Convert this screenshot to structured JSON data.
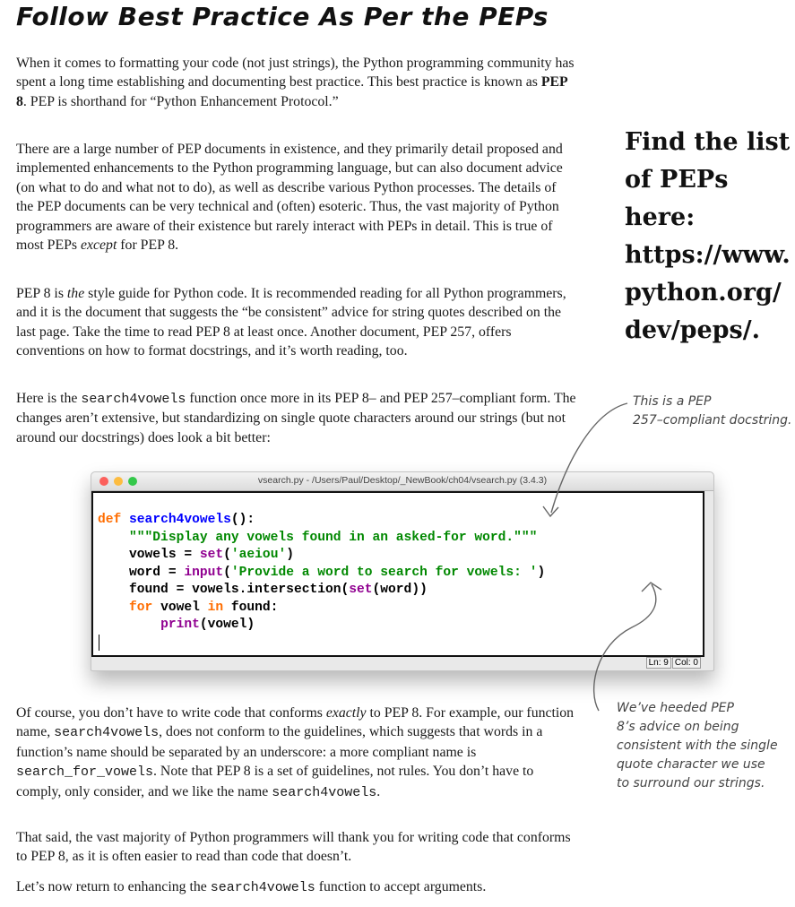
{
  "heading": "Follow Best Practice As Per the PEPs",
  "paragraphs": {
    "p1": {
      "a": "When it comes to formatting your code (not just strings), the Python programming community has spent a long time establishing and documenting best practice. This best practice is known as ",
      "b": "PEP 8",
      "c": ".  PEP is shorthand for “Python Enhancement Protocol.”"
    },
    "p2": {
      "a": "There are a large number of PEP documents in existence, and they primarily detail proposed and implemented enhancements to the Python programming language, but can also document advice (on what to do and what not to do), as well as describe various Python processes. The details of the PEP documents can be very technical and (often) esoteric. Thus, the vast majority of Python programmers are aware of their existence but rarely interact with PEPs in detail. This is true of most PEPs ",
      "b": "except",
      "c": " for PEP 8."
    },
    "p3": {
      "a": "PEP 8 is ",
      "b": "the",
      "c": " style guide for Python code. It is recommended reading for all Python programmers, and it is the document that suggests the “be consistent” advice for string quotes described on the last page. Take the time to read PEP 8 at least once. Another document, PEP 257, offers conventions on how to format docstrings, and it’s worth reading, too."
    },
    "p4": {
      "a": "Here is the ",
      "code": "search4vowels",
      "b": " function once more in its PEP 8– and PEP 257–compliant form. The changes aren’t extensive, but standardizing on single quote characters around our strings (but not around our docstrings) does look a bit better:"
    },
    "p5": {
      "a": "Of course, you don’t have to write code that conforms ",
      "b": "exactly",
      "c": " to PEP 8. For example, our function name, ",
      "code1": "search4vowels",
      "d": ", does not conform to the guidelines, which suggests that words in a function’s name should be separated by an underscore: a more compliant name is ",
      "code2": "search_for_vowels",
      "e": ". Note that PEP 8 is a set of guidelines, not rules. You don’t have to comply, only consider, and we like the name ",
      "code3": "search4vowels",
      "f": "."
    },
    "p6": "That said, the vast majority of Python programmers will thank you for writing code that conforms to PEP 8, as it is often easier to read than code that doesn’t.",
    "p7": {
      "a": "Let’s now return to enhancing the ",
      "code": "search4vowels",
      "b": " function to accept arguments."
    }
  },
  "callout": {
    "line1": "Find the list",
    "line2": "of PEPs here:",
    "line3": "https://www.",
    "line4": "python.org/",
    "line5": "dev/peps/."
  },
  "annotation_docstring": {
    "line1": "This is a PEP",
    "line2": "257–compliant docstring."
  },
  "annotation_quotes": {
    "line1": "We’ve heeded PEP",
    "line2": "8’s advice on being",
    "line3": "consistent with the single",
    "line4": "quote character we use",
    "line5": "to surround our strings."
  },
  "editor_window": {
    "title": "vsearch.py - /Users/Paul/Desktop/_NewBook/ch04/vsearch.py (3.4.3)",
    "status_line": "Ln: 9",
    "status_col": "Col: 0",
    "traffic_lights": {
      "close": "#fc605c",
      "minimize": "#fdbc40",
      "zoom": "#34c84a"
    }
  },
  "code": {
    "l1": {
      "kw": "def",
      "name": "search4vowels",
      "rest": "():"
    },
    "l2": {
      "doc": "\"\"\"Display any vowels found in an asked-for word.\"\"\""
    },
    "l3": {
      "a": "vowels = ",
      "fn": "set",
      "b": "(",
      "str": "'aeiou'",
      "c": ")"
    },
    "l4": {
      "a": "word = ",
      "fn": "input",
      "b": "(",
      "str": "'Provide a word to search for vowels: '",
      "c": ")"
    },
    "l5": {
      "a": "found = vowels.intersection(",
      "fn": "set",
      "b": "(word))"
    },
    "l6": {
      "kw1": "for",
      "a": " vowel ",
      "kw2": "in",
      "b": " found:"
    },
    "l7": {
      "fn": "print",
      "a": "(vowel)"
    }
  },
  "colors": {
    "keyword": "#ff6d00",
    "function_name": "#0000ff",
    "builtin": "#900090",
    "string": "#008800"
  }
}
